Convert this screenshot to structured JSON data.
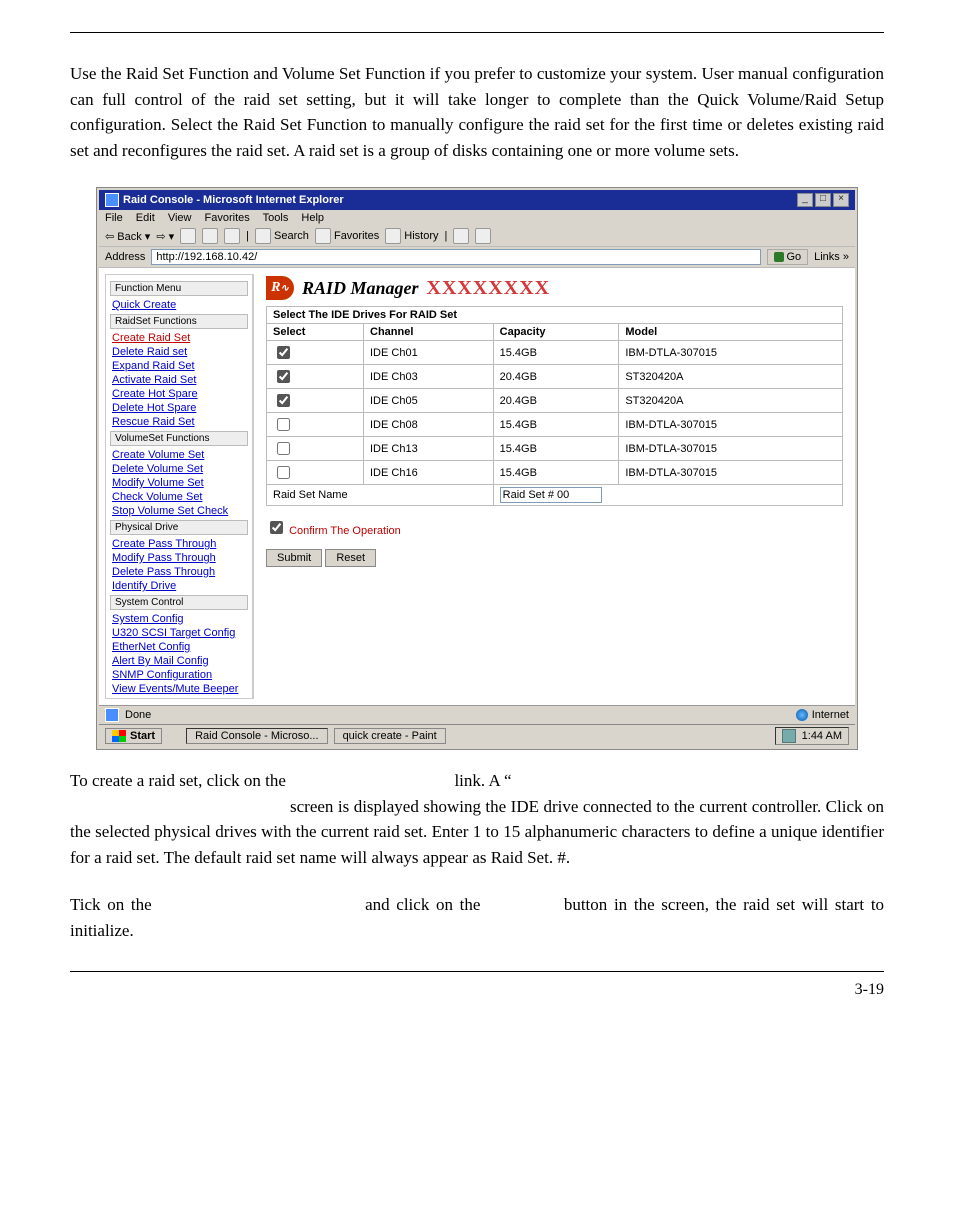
{
  "body": {
    "intro": "Use the Raid Set Function and Volume Set Function if you prefer to customize your system. User manual configuration can full control of the raid set setting, but it will take longer to complete than the Quick Volume/Raid Setup configuration. Select the Raid Set Function to manually configure the raid set for the first time or deletes existing raid set and reconfigures the raid set. A raid set is a group of disks containing one or more volume sets.",
    "p2a": "To create a raid set, click on the",
    "p2b": "link. A “",
    "p2c": "screen is displayed showing the IDE drive connected to the current controller. Click on the selected physical drives with the current raid set. Enter 1 to 15 alphanumeric characters to define a unique identifier for a raid set. The default raid set name will always appear as Raid Set. #.",
    "p3a": "Tick on the",
    "p3b": "and click on the",
    "p3c": "button in the screen, the raid set will start to initialize."
  },
  "app": {
    "title": "Raid Console - Microsoft Internet Explorer",
    "menus": [
      "File",
      "Edit",
      "View",
      "Favorites",
      "Tools",
      "Help"
    ],
    "toolbar": {
      "back": "Back",
      "search": "Search",
      "fav": "Favorites",
      "hist": "History"
    },
    "address_label": "Address",
    "address_value": "http://192.168.10.42/",
    "go": "Go",
    "links": "Links",
    "sidebar": {
      "group1": "Function Menu",
      "quick_create": "Quick Create",
      "group2": "RaidSet Functions",
      "create_raid_set": "Create Raid Set",
      "delete_raid_set": "Delete Raid set",
      "expand_raid_set": "Expand Raid Set",
      "activate_raid_set": "Activate Raid Set",
      "create_hot_spare": "Create Hot Spare",
      "delete_hot_spare": "Delete Hot Spare",
      "rescue_raid_set": "Rescue Raid Set",
      "group3": "VolumeSet Functions",
      "create_vol": "Create Volume Set",
      "delete_vol": "Delete Volume Set",
      "modify_vol": "Modify Volume Set",
      "check_vol": "Check Volume Set",
      "stop_vol": "Stop Volume Set Check",
      "group4": "Physical Drive",
      "create_pt": "Create Pass Through",
      "modify_pt": "Modify Pass Through",
      "delete_pt": "Delete Pass Through",
      "identify": "Identify Drive",
      "group5": "System Control",
      "sys_config": "System Config",
      "u320": "U320 SCSI Target Config",
      "ethernet": "EtherNet Config",
      "alert": "Alert By Mail Config",
      "snmp": "SNMP Configuration",
      "view": "View Events/Mute Beeper"
    },
    "main": {
      "brand1": "RAID ",
      "brand2": "Manager",
      "xxx": "XXXXXXXX",
      "section_title": "Select The IDE Drives For RAID Set",
      "cols": {
        "select": "Select",
        "channel": "Channel",
        "capacity": "Capacity",
        "model": "Model"
      },
      "rows": [
        {
          "sel": true,
          "channel": "IDE Ch01",
          "cap": "15.4GB",
          "model": "IBM-DTLA-307015"
        },
        {
          "sel": true,
          "channel": "IDE Ch03",
          "cap": "20.4GB",
          "model": "ST320420A"
        },
        {
          "sel": true,
          "channel": "IDE Ch05",
          "cap": "20.4GB",
          "model": "ST320420A"
        },
        {
          "sel": false,
          "channel": "IDE Ch08",
          "cap": "15.4GB",
          "model": "IBM-DTLA-307015"
        },
        {
          "sel": false,
          "channel": "IDE Ch13",
          "cap": "15.4GB",
          "model": "IBM-DTLA-307015"
        },
        {
          "sel": false,
          "channel": "IDE Ch16",
          "cap": "15.4GB",
          "model": "IBM-DTLA-307015"
        }
      ],
      "name_label": "Raid Set Name",
      "name_value": "Raid Set # 00",
      "confirm": "Confirm The Operation",
      "submit": "Submit",
      "reset": "Reset"
    },
    "status": {
      "done": "Done",
      "internet": "Internet"
    },
    "taskbar": {
      "start": "Start",
      "task1": "Raid Console - Microso...",
      "task2": "quick create - Paint",
      "time": "1:44 AM"
    }
  },
  "page_number": "3-19"
}
